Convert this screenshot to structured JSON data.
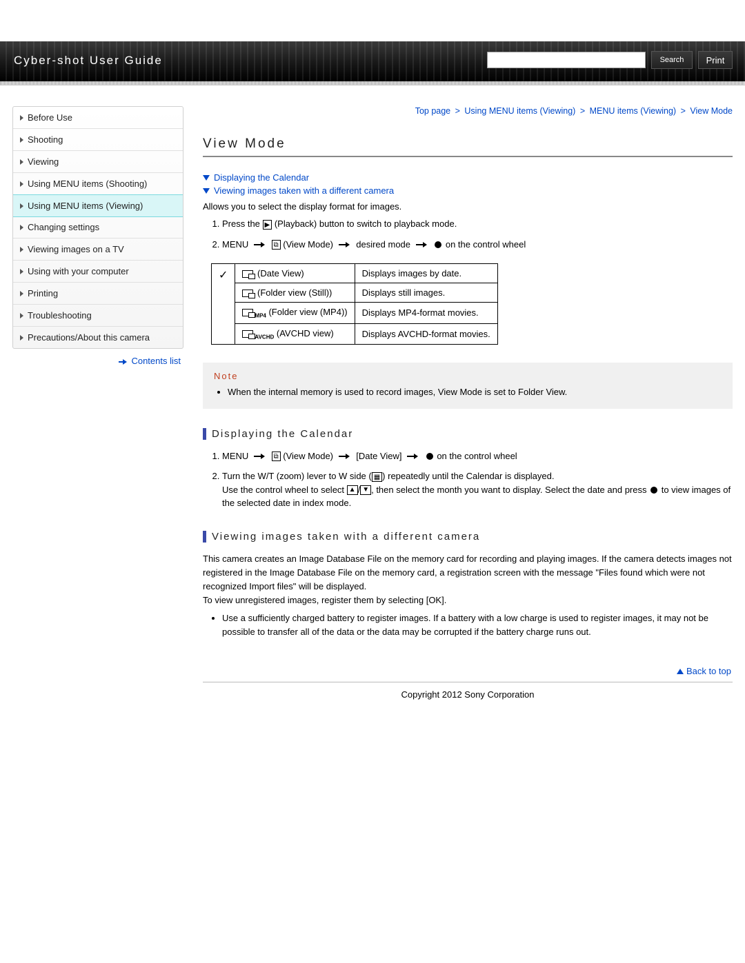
{
  "header": {
    "title": "Cyber-shot User Guide",
    "search_placeholder": "",
    "search_button": "Search",
    "print_button": "Print"
  },
  "sidebar": {
    "items": [
      {
        "label": "Before Use"
      },
      {
        "label": "Shooting"
      },
      {
        "label": "Viewing"
      },
      {
        "label": "Using MENU items (Shooting)"
      },
      {
        "label": "Using MENU items (Viewing)"
      },
      {
        "label": "Changing settings"
      },
      {
        "label": "Viewing images on a TV"
      },
      {
        "label": "Using with your computer"
      },
      {
        "label": "Printing"
      },
      {
        "label": "Troubleshooting"
      },
      {
        "label": "Precautions/About this camera"
      }
    ],
    "contents_link": "Contents list"
  },
  "breadcrumb": {
    "items": [
      "Top page",
      "Using MENU items (Viewing)",
      "MENU items (Viewing)"
    ],
    "current": "View Mode",
    "sep": ">"
  },
  "page": {
    "title": "View Mode",
    "anchors": [
      "Displaying the Calendar",
      "Viewing images taken with a different camera"
    ],
    "intro": "Allows you to select the display format for images.",
    "step1_a": "Press the ",
    "step1_b": " (Playback) button to switch to playback mode.",
    "step2_a": "MENU ",
    "step2_b": " (View Mode) ",
    "step2_c": " desired mode ",
    "step2_d": " on the control wheel",
    "table": [
      {
        "name": " (Date View)",
        "desc": "Displays images by date.",
        "check": true
      },
      {
        "name": " (Folder view (Still))",
        "desc": "Displays still images."
      },
      {
        "name_sub": "MP4",
        "name": " (Folder view (MP4))",
        "desc": "Displays MP4-format movies."
      },
      {
        "name_sub": "AVCHD",
        "name": " (AVCHD view)",
        "desc": "Displays AVCHD-format movies."
      }
    ],
    "note_title": "Note",
    "note_text": "When the internal memory is used to record images, View Mode is set to Folder View.",
    "sec1": {
      "title": "Displaying the Calendar",
      "s1_a": "MENU ",
      "s1_b": " (View Mode) ",
      "s1_c": " [Date View] ",
      "s1_d": " on the control wheel",
      "s2_a": "Turn the W/T (zoom) lever to W side (",
      "s2_b": ") repeatedly until the Calendar is displayed.",
      "s2_c": "Use the control wheel to select ",
      "s2_d": ", then select the month you want to display. Select the date and press ",
      "s2_e": " to view images of the selected date in index mode."
    },
    "sec2": {
      "title": "Viewing images taken with a different camera",
      "p1": "This camera creates an Image Database File on the memory card for recording and playing images. If the camera detects images not registered in the Image Database File on the memory card, a registration screen with the message \"Files found which were not recognized Import files\" will be displayed.",
      "p2": "To view unregistered images, register them by selecting [OK].",
      "bullet": "Use a sufficiently charged battery to register images. If a battery with a low charge is used to register images, it may not be possible to transfer all of the data or the data may be corrupted if the battery charge runs out."
    },
    "back_top": "Back to top"
  },
  "footer": {
    "copyright": "Copyright 2012 Sony Corporation"
  }
}
